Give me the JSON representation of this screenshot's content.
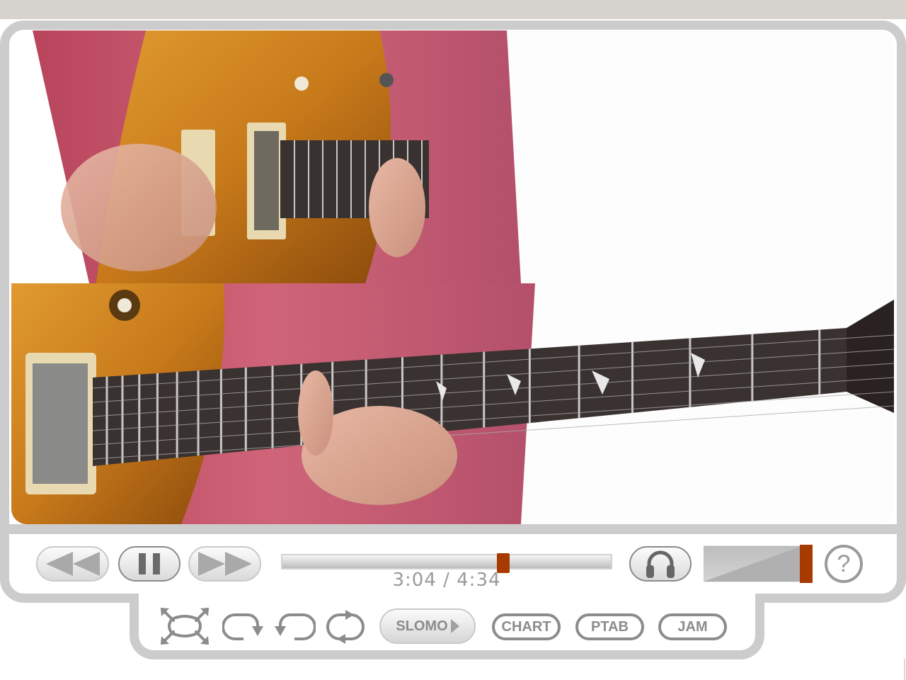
{
  "window": {
    "title_bar": ""
  },
  "video": {
    "description": "Close-up of guitarist in pink shirt playing sunburst electric guitar (split-screen: picking hand above, fretting hand below)",
    "colors": {
      "shirt": "#c4566a",
      "body": "#c87a1a",
      "fretboard": "#3a3230",
      "background": "#fdfdfd"
    }
  },
  "transport": {
    "rewind": {
      "icon": "rewind-icon",
      "label": "Rewind"
    },
    "pause": {
      "icon": "pause-icon",
      "label": "Pause"
    },
    "fast_forward": {
      "icon": "fast-forward-icon",
      "label": "Fast forward"
    },
    "seek": {
      "current": "3:04",
      "total": "4:34",
      "progress": 0.672
    },
    "time_text": "3:04 / 4:34",
    "audio": {
      "icon": "headphones-icon",
      "label": "Audio"
    },
    "volume": {
      "level": 1.0
    },
    "help": {
      "icon": "help-icon",
      "label": "?"
    }
  },
  "toolbar": {
    "fullscreen": {
      "icon": "fullscreen-icon"
    },
    "loop_forward": {
      "icon": "loop-forward-icon"
    },
    "loop_back": {
      "icon": "loop-back-icon"
    },
    "loop_repeat": {
      "icon": "repeat-icon"
    },
    "slomo_label": "SLOMO",
    "chart_label": "CHART",
    "ptab_label": "PTAB",
    "jam_label": "JAM"
  },
  "accent_color": "#a63a00"
}
